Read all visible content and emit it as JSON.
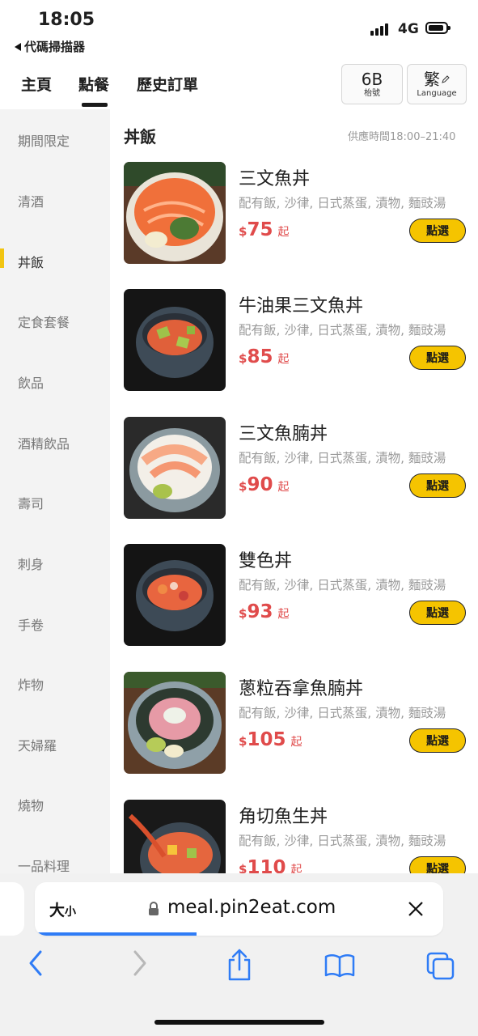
{
  "status_bar": {
    "time": "18:05",
    "back_app": "代碼掃描器",
    "network": "4G",
    "icons": [
      "signal-icon",
      "battery-icon"
    ]
  },
  "nav": {
    "tabs": [
      {
        "label": "主頁",
        "active": false
      },
      {
        "label": "點餐",
        "active": true
      },
      {
        "label": "歷史訂單",
        "active": false
      }
    ],
    "table": {
      "number": "6B",
      "caption": "枱號"
    },
    "language": {
      "glyph": "繁",
      "caption": "Language",
      "icon": "pencil-icon"
    }
  },
  "categories": [
    {
      "label": "期間限定",
      "active": false
    },
    {
      "label": "清酒",
      "active": false
    },
    {
      "label": "丼飯",
      "active": true
    },
    {
      "label": "定食套餐",
      "active": false
    },
    {
      "label": "飲品",
      "active": false
    },
    {
      "label": "酒精飲品",
      "active": false
    },
    {
      "label": "壽司",
      "active": false
    },
    {
      "label": "刺身",
      "active": false
    },
    {
      "label": "手卷",
      "active": false
    },
    {
      "label": "炸物",
      "active": false
    },
    {
      "label": "天婦羅",
      "active": false
    },
    {
      "label": "燒物",
      "active": false
    },
    {
      "label": "一品料理",
      "active": false
    }
  ],
  "section": {
    "title": "丼飯",
    "service_time": "供應時間18:00–21:40"
  },
  "menu_items": [
    {
      "name": "三文魚丼",
      "desc": "配有飯, 沙律, 日式蒸蛋, 漬物, 麵豉湯",
      "currency": "$",
      "price": "75",
      "suffix": "起",
      "button": "點選"
    },
    {
      "name": "牛油果三文魚丼",
      "desc": "配有飯, 沙律, 日式蒸蛋, 漬物, 麵豉湯",
      "currency": "$",
      "price": "85",
      "suffix": "起",
      "button": "點選"
    },
    {
      "name": "三文魚腩丼",
      "desc": "配有飯, 沙律, 日式蒸蛋, 漬物, 麵豉湯",
      "currency": "$",
      "price": "90",
      "suffix": "起",
      "button": "點選"
    },
    {
      "name": "雙色丼",
      "desc": "配有飯, 沙律, 日式蒸蛋, 漬物, 麵豉湯",
      "currency": "$",
      "price": "93",
      "suffix": "起",
      "button": "點選"
    },
    {
      "name": "蔥粒吞拿魚腩丼",
      "desc": "配有飯, 沙律, 日式蒸蛋, 漬物, 麵豉湯",
      "currency": "$",
      "price": "105",
      "suffix": "起",
      "button": "點選"
    },
    {
      "name": "角切魚生丼",
      "desc": "配有飯, 沙律, 日式蒸蛋, 漬物, 麵豉湯",
      "currency": "$",
      "price": "110",
      "suffix": "起",
      "button": "點選"
    }
  ],
  "browser": {
    "text_size_big": "大",
    "text_size_small": "小",
    "url": "meal.pin2eat.com",
    "toolbar_icons": [
      "back-icon",
      "forward-icon",
      "share-icon",
      "bookmarks-icon",
      "tabs-icon"
    ]
  },
  "colors": {
    "accent_yellow": "#f5c400",
    "price_red": "#e04b4b",
    "link_blue": "#2f7cf6",
    "sidebar_bg": "#f3f3f3"
  }
}
